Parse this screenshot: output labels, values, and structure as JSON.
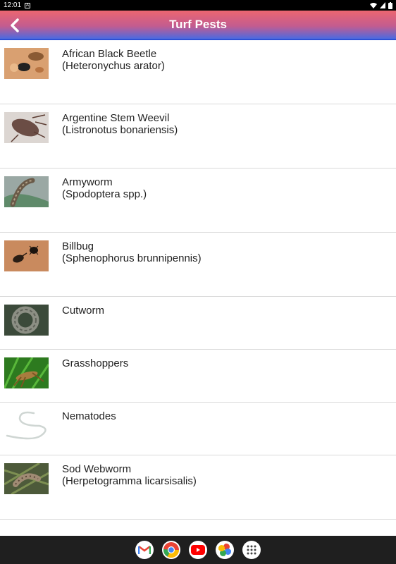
{
  "status": {
    "time": "12:01"
  },
  "appbar": {
    "title": "Turf Pests"
  },
  "pests": [
    {
      "name": "African Black Beetle",
      "scientific": "(Heteronychus arator)"
    },
    {
      "name": "Argentine Stem Weevil",
      "scientific": "(Listronotus bonariensis)"
    },
    {
      "name": "Armyworm",
      "scientific": "(Spodoptera spp.)"
    },
    {
      "name": "Billbug",
      "scientific": "(Sphenophorus brunnipennis)"
    },
    {
      "name": "Cutworm",
      "scientific": ""
    },
    {
      "name": "Grasshoppers",
      "scientific": ""
    },
    {
      "name": "Nematodes",
      "scientific": ""
    },
    {
      "name": "Sod Webworm",
      "scientific": "(Herpetogramma licarsisalis)"
    }
  ],
  "dock": [
    "gmail-icon",
    "chrome-icon",
    "youtube-icon",
    "photos-icon",
    "app-drawer-icon"
  ]
}
